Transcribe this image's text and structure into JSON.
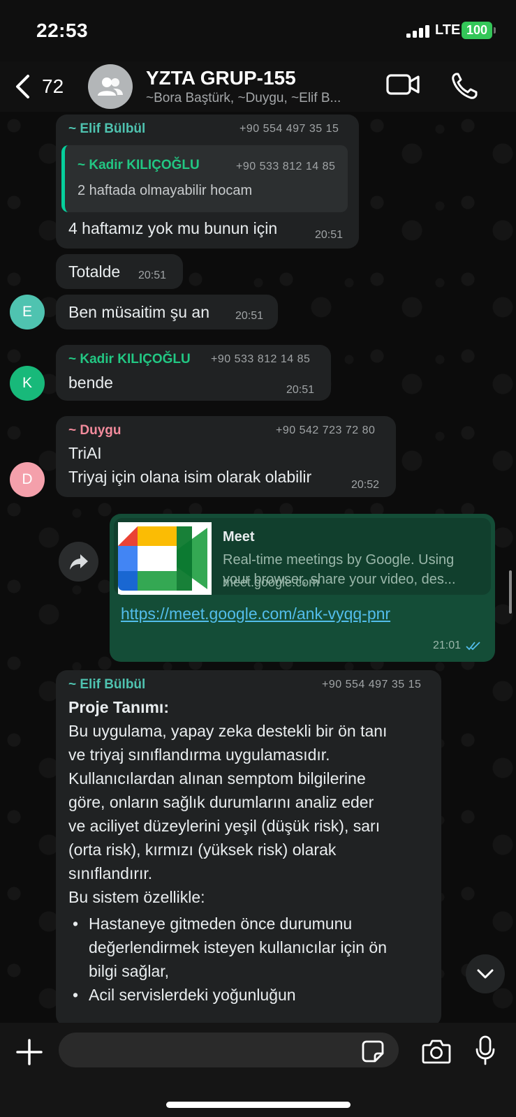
{
  "status_bar": {
    "time": "22:53",
    "network": "LTE",
    "battery": "100"
  },
  "header": {
    "back_count": "72",
    "title": "YZTA GRUP-155",
    "members": "~Bora Baştürk, ~Duygu, ~Elif B..."
  },
  "colors": {
    "elif": "#4fc3b0",
    "kadir": "#22c783",
    "duygu": "#f28b9c",
    "avatar_e": "#4fc3b0",
    "avatar_k": "#18b97a",
    "avatar_d": "#f4a0ab",
    "outgoing_bubble": "#144d37",
    "incoming_bubble": "#202223"
  },
  "messages": [
    {
      "sender": "~ Elif Bülbül",
      "phone": "+90 554 497 35 15",
      "quote": {
        "sender": "~ Kadir KILIÇOĞLU",
        "phone": "+90 533 812 14 85",
        "text": "2 haftada olmayabilir hocam"
      },
      "text": "4 haftamız yok mu bunun için",
      "time": "20:51"
    },
    {
      "text": "Totalde",
      "time": "20:51"
    },
    {
      "avatar": "E",
      "text": "Ben müsaitim şu an",
      "time": "20:51"
    },
    {
      "avatar": "K",
      "sender": "~ Kadir KILIÇOĞLU",
      "phone": "+90 533 812 14 85",
      "text": "bende",
      "time": "20:51"
    },
    {
      "avatar": "D",
      "sender": "~ Duygu",
      "phone": "+90 542 723 72 80",
      "line1": "TriAI",
      "line2": "Triyaj için olana isim olarak olabilir",
      "time": "20:52"
    },
    {
      "link_title": "Meet",
      "link_desc_1": "Real-time meetings by Google. Using",
      "link_desc_2": "your browser, share your video, des...",
      "link_domain": "meet.google.com",
      "url": "https://meet.google.com/ank-vyqq-pnr",
      "time": "21:01"
    },
    {
      "sender": "~ Elif Bülbül",
      "phone": "+90 554 497 35 15",
      "heading": "Proje Tanımı:",
      "paragraph": [
        "Bu uygulama, yapay zeka destekli bir ön tanı",
        "ve triyaj sınıflandırma uygulamasıdır.",
        "Kullanıcılardan alınan semptom bilgilerine",
        "göre, onların sağlık durumlarını analiz eder",
        "ve aciliyet düzeylerini yeşil (düşük risk), sarı",
        "(orta risk), kırmızı (yüksek risk) olarak",
        "sınıflandırır."
      ],
      "intro": "Bu sistem özellikle:",
      "bullets": [
        [
          "Hastaneye gitmeden önce durumunu",
          "değerlendirmek isteyen kullanıcılar için ön",
          "bilgi sağlar,"
        ],
        [
          "Acil servislerdeki yoğunluğun"
        ]
      ]
    }
  ],
  "composer": {
    "placeholder": ""
  }
}
